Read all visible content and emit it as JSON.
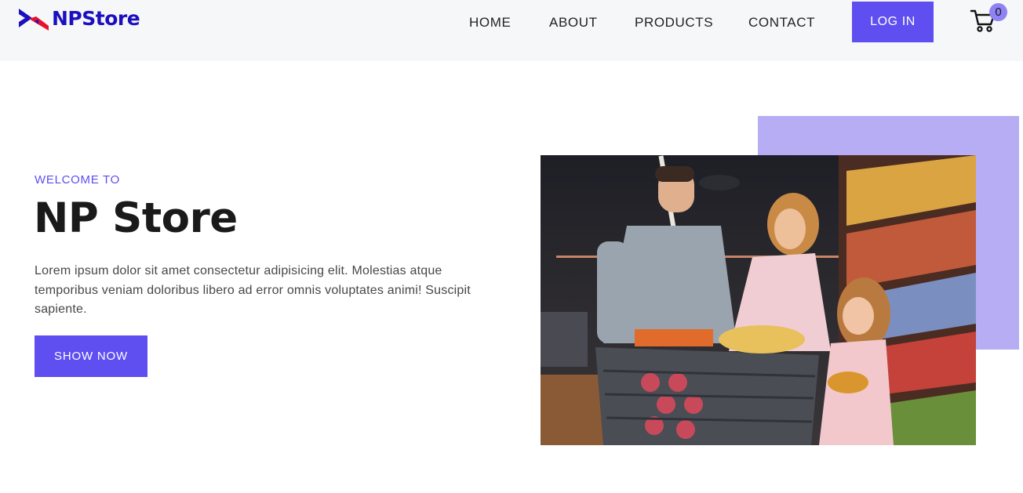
{
  "header": {
    "brand": "NPStore",
    "nav": [
      {
        "label": "HOME"
      },
      {
        "label": "ABOUT"
      },
      {
        "label": "PRODUCTS"
      },
      {
        "label": "CONTACT"
      }
    ],
    "login_label": "LOG IN",
    "cart_count": "0",
    "cart_icon": "shopping-cart-icon"
  },
  "hero": {
    "kicker": "WELCOME TO",
    "title": "NP Store",
    "text": "Lorem ipsum dolor sit amet consectetur adipisicing elit. Molestias atque temporibus veniam doloribus libero ad error omnis voluptates animi! Suscipit sapiente.",
    "button_label": "SHOW NOW",
    "image_description": "family shopping in a grocery store"
  },
  "colors": {
    "accent": "#5f4ef0",
    "accent_light": "#b6adf5",
    "brand": "#1b0fc0",
    "navbar_bg": "#f6f7f9"
  }
}
